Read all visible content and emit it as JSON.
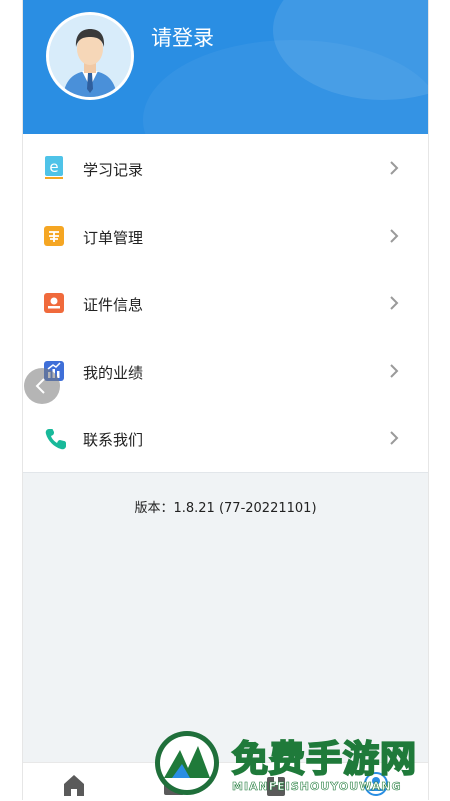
{
  "header": {
    "login_label": "请登录",
    "avatar_icon": "user-avatar-icon",
    "bg_color": "#2a8ee3"
  },
  "menu": {
    "items": [
      {
        "label": "学习记录",
        "icon": "study-record-icon"
      },
      {
        "label": "订单管理",
        "icon": "order-icon"
      },
      {
        "label": "证件信息",
        "icon": "certificate-icon"
      },
      {
        "label": "我的业绩",
        "icon": "performance-chart-icon"
      },
      {
        "label": "联系我们",
        "icon": "phone-icon"
      }
    ],
    "chevron_icon": "chevron-right-icon"
  },
  "footer": {
    "version_text": "版本：1.8.21 (77-20221101)"
  },
  "tabbar": {
    "tabs": [
      {
        "icon": "home-icon"
      },
      {
        "icon": "learn-icon"
      },
      {
        "icon": "book-icon"
      },
      {
        "icon": "profile-icon"
      }
    ],
    "active_color": "#2a8ee3"
  },
  "watermark": {
    "title": "免费手游网",
    "subtitle": "MIANFEISHOUYOUWANG"
  }
}
